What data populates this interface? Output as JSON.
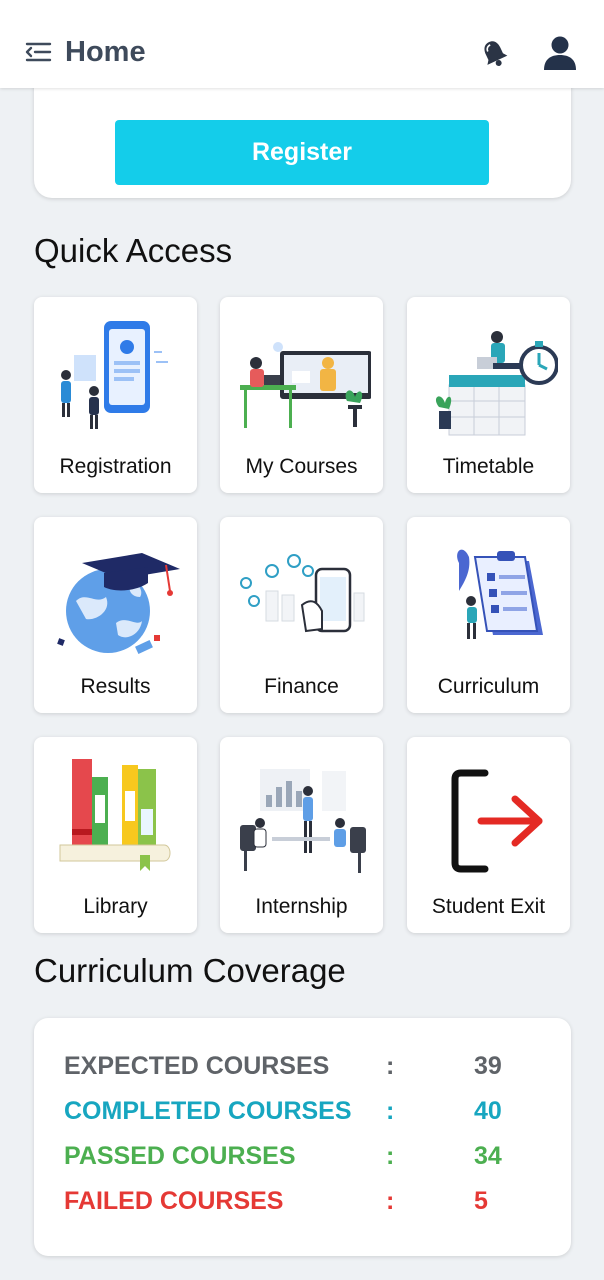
{
  "header": {
    "title": "Home"
  },
  "register": {
    "button_label": "Register"
  },
  "quick_access": {
    "title": "Quick Access",
    "tiles": [
      {
        "label": "Registration"
      },
      {
        "label": "My Courses"
      },
      {
        "label": "Timetable"
      },
      {
        "label": "Results"
      },
      {
        "label": "Finance"
      },
      {
        "label": "Curriculum"
      },
      {
        "label": "Library"
      },
      {
        "label": "Internship"
      },
      {
        "label": "Student Exit"
      }
    ]
  },
  "coverage": {
    "title": "Curriculum Coverage",
    "rows": [
      {
        "label": "EXPECTED COURSES",
        "separator": ":",
        "value": "39",
        "color": "#5f6368"
      },
      {
        "label": "COMPLETED COURSES",
        "separator": ":",
        "value": "40",
        "color": "#17a6c0"
      },
      {
        "label": "PASSED COURSES",
        "separator": ":",
        "value": "34",
        "color": "#4caf50"
      },
      {
        "label": "FAILED COURSES",
        "separator": ":",
        "value": "5",
        "color": "#e53935"
      }
    ]
  }
}
